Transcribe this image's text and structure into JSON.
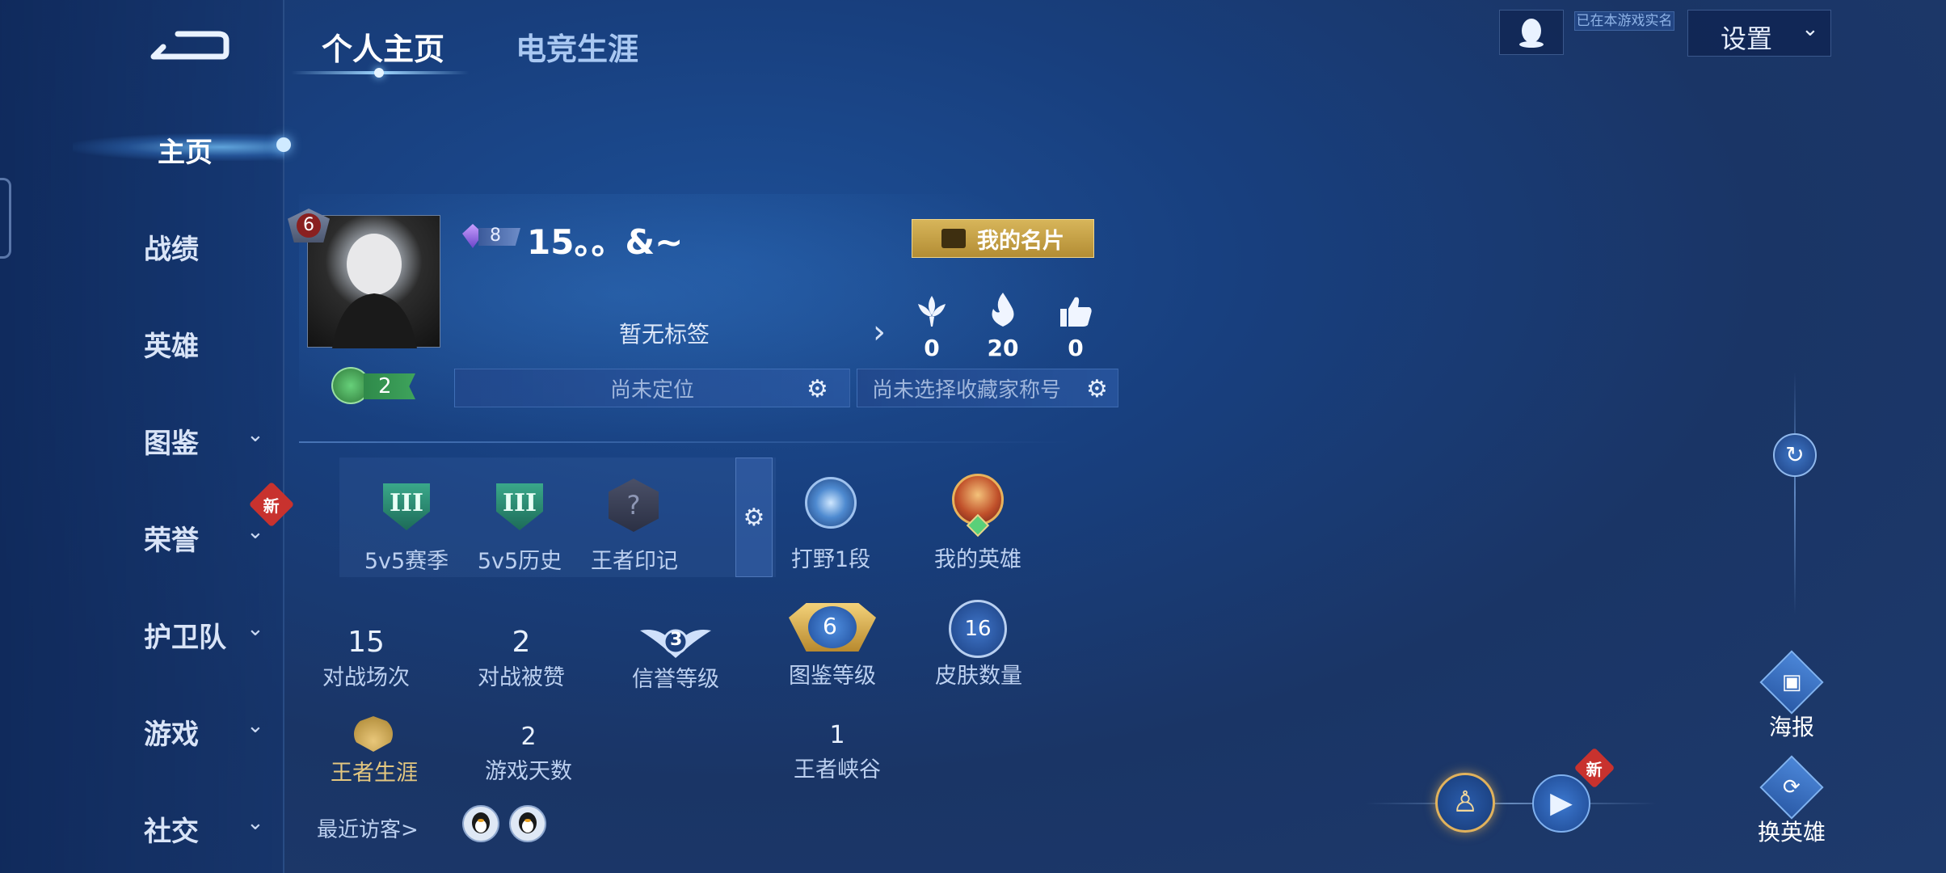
{
  "tabs": [
    {
      "label": "个人主页",
      "active": true
    },
    {
      "label": "电竞生涯",
      "active": false
    }
  ],
  "sidebar": {
    "items": [
      {
        "label": "主页",
        "active": true,
        "has_chevron": false
      },
      {
        "label": "战绩",
        "active": false,
        "has_chevron": false
      },
      {
        "label": "英雄",
        "active": false,
        "has_chevron": false
      },
      {
        "label": "图鉴",
        "active": false,
        "has_chevron": true
      },
      {
        "label": "荣誉",
        "active": false,
        "has_chevron": true,
        "badge": "新"
      },
      {
        "label": "护卫队",
        "active": false,
        "has_chevron": true
      },
      {
        "label": "游戏",
        "active": false,
        "has_chevron": true
      },
      {
        "label": "社交",
        "active": false,
        "has_chevron": true
      }
    ]
  },
  "topbar": {
    "realname_tag": "已在本游戏实名",
    "settings_label": "设置"
  },
  "profile": {
    "avatar_level": "6",
    "vip_level": "8",
    "nickname": "15。。&~",
    "card_button": "我的名片",
    "tag_text": "暂无标签",
    "stats": [
      {
        "icon": "lotus-icon",
        "value": "0"
      },
      {
        "icon": "fire-icon",
        "value": "20"
      },
      {
        "icon": "thumbs-up-icon",
        "value": "0"
      }
    ],
    "star_level": "2",
    "location_slot": "尚未定位",
    "collector_slot": "尚未选择收藏家称号"
  },
  "honors": [
    {
      "label": "5v5赛季",
      "icon": "rank-shield-icon",
      "icon_text": "III"
    },
    {
      "label": "5v5历史",
      "icon": "rank-shield-icon",
      "icon_text": "III"
    },
    {
      "label": "王者印记",
      "icon": "question-hex-icon",
      "icon_text": "?"
    },
    {
      "label": "打野1段",
      "icon": "jungle-icon"
    },
    {
      "label": "我的英雄",
      "icon": "hero-portrait-icon"
    }
  ],
  "counts": [
    {
      "value": "15",
      "label": "对战场次"
    },
    {
      "value": "2",
      "label": "对战被赞"
    },
    {
      "value": "3",
      "label": "信誉等级"
    },
    {
      "value": "6",
      "label": "图鉴等级"
    },
    {
      "value": "16",
      "label": "皮肤数量"
    }
  ],
  "career": [
    {
      "label": "王者生涯"
    },
    {
      "value": "2",
      "label": "游戏天数"
    },
    {
      "value": "1",
      "label": "王者峡谷"
    }
  ],
  "visitors": {
    "label": "最近访客>",
    "avatars": [
      "penguin-icon",
      "penguin-icon"
    ]
  },
  "right_panel": {
    "poster_label": "海报",
    "switch_hero_label": "换英雄",
    "play_badge": "新"
  },
  "colors": {
    "accent_gold": "#c9a548",
    "bg_blue": "#1a3c78",
    "badge_red": "#c8322e"
  }
}
